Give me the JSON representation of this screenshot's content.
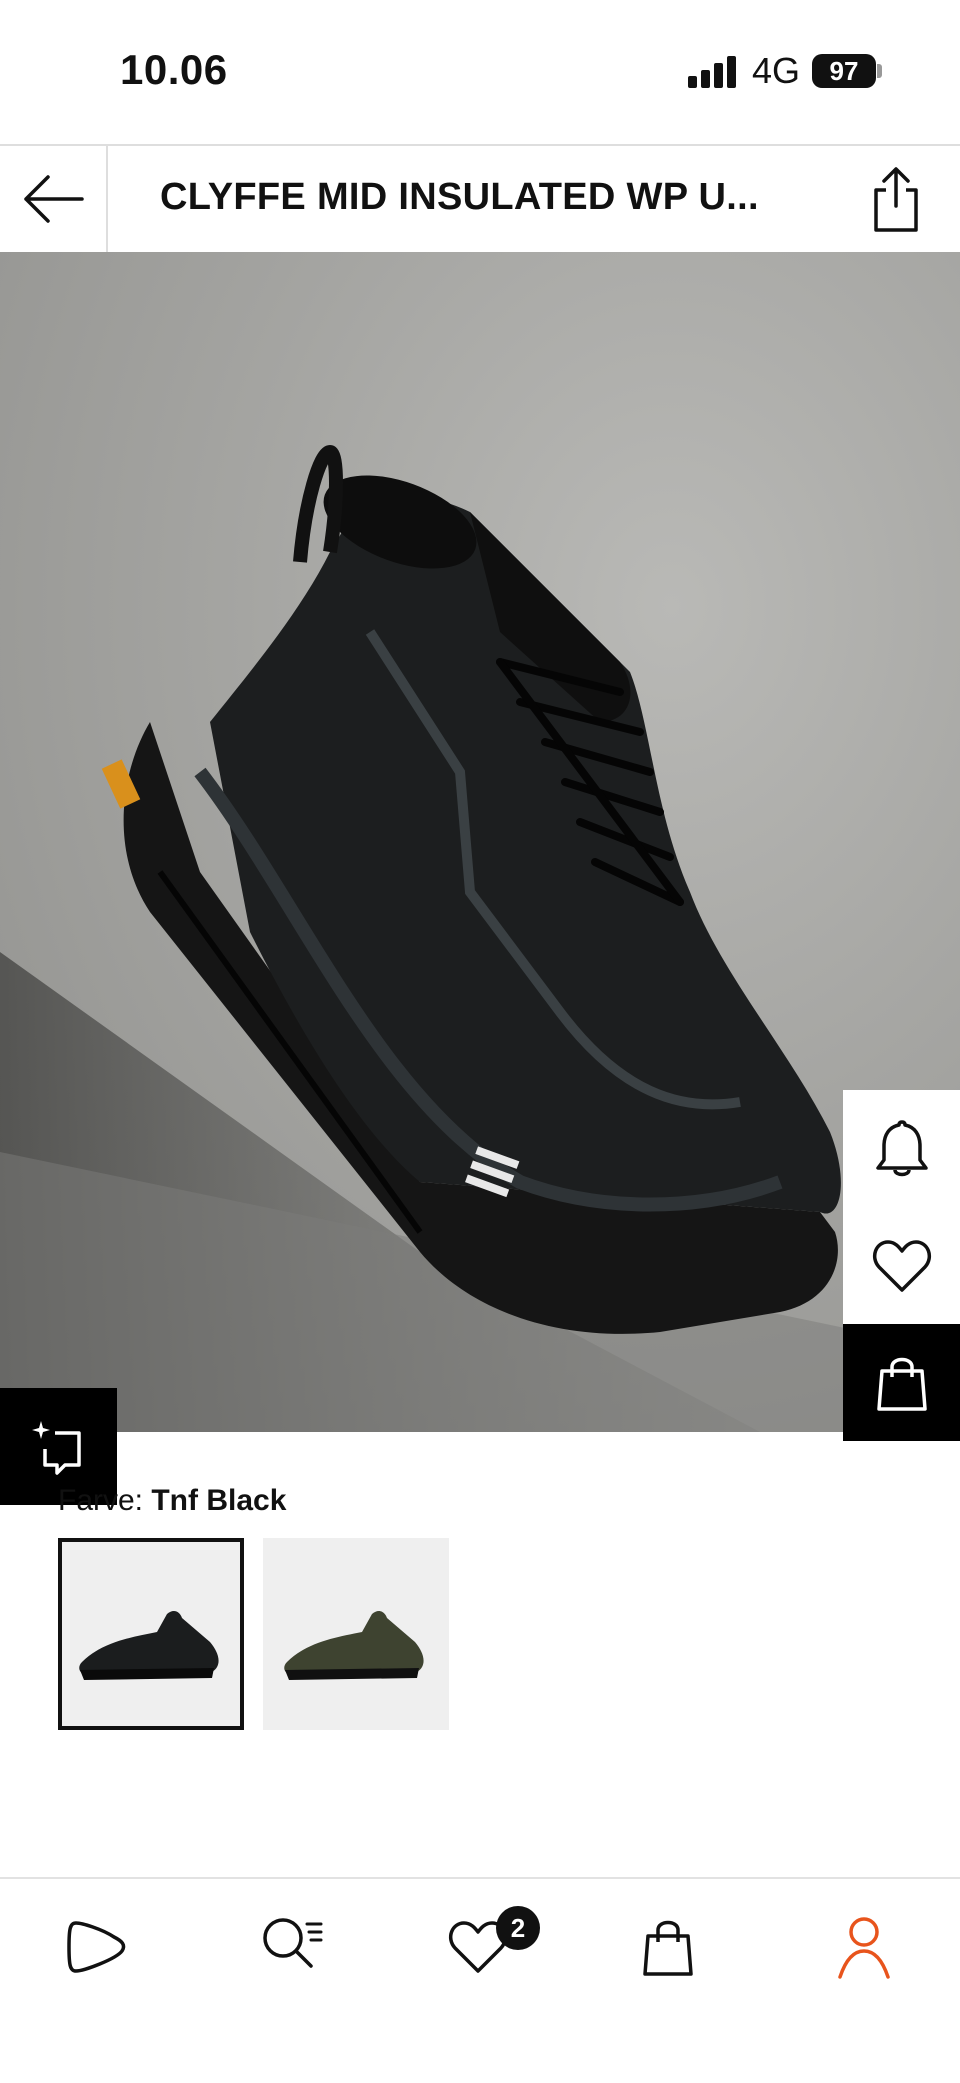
{
  "status_bar": {
    "time": "10.06",
    "network": "4G",
    "battery": "97"
  },
  "header": {
    "title": "CLYFFE MID INSULATED WP U..."
  },
  "colour": {
    "prefix": "Farve: ",
    "value": "Tnf Black"
  },
  "swatches": [
    {
      "name": "Tnf Black",
      "selected": true,
      "upper_color": "#1b1d1e"
    },
    {
      "name": "Olive",
      "selected": false,
      "upper_color": "#3e4330"
    }
  ],
  "nav": {
    "items": [
      "home",
      "search",
      "wishlist",
      "bag",
      "account"
    ],
    "wishlist_count": "2",
    "active_color": "#e8541c"
  },
  "icons": {
    "back": "arrow-left-icon",
    "share": "share-icon",
    "bell": "bell-icon",
    "heart": "heart-icon",
    "bag": "shopping-bag-icon",
    "ai": "sparkle-crop-icon"
  }
}
